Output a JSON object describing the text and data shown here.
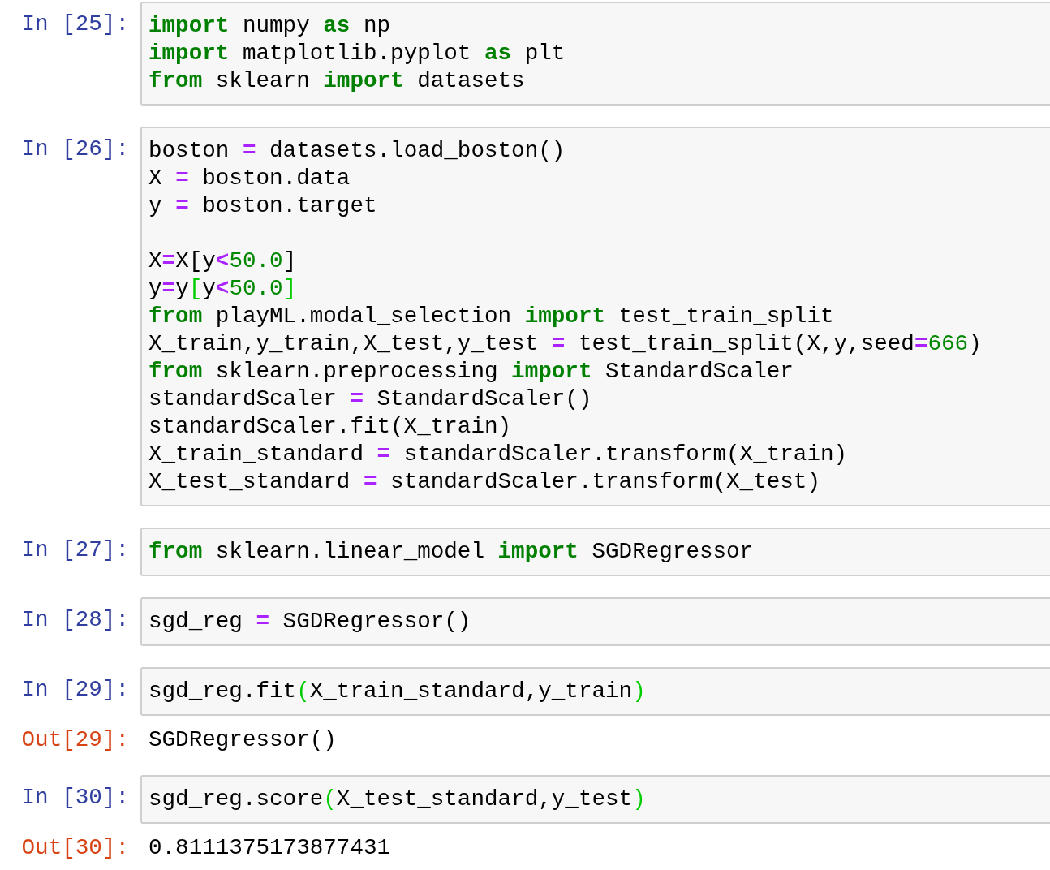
{
  "cells": [
    {
      "prompt": "In [25]:",
      "lines": [
        {
          "tokens": [
            {
              "kind": "kw",
              "text": "import"
            },
            {
              "kind": "plain",
              "text": " numpy "
            },
            {
              "kind": "kw",
              "text": "as"
            },
            {
              "kind": "plain",
              "text": " np"
            }
          ]
        },
        {
          "tokens": [
            {
              "kind": "kw",
              "text": "import"
            },
            {
              "kind": "plain",
              "text": " matplotlib.pyplot "
            },
            {
              "kind": "kw",
              "text": "as"
            },
            {
              "kind": "plain",
              "text": " plt"
            }
          ]
        },
        {
          "tokens": [
            {
              "kind": "kw",
              "text": "from"
            },
            {
              "kind": "plain",
              "text": " sklearn "
            },
            {
              "kind": "kw",
              "text": "import"
            },
            {
              "kind": "plain",
              "text": " datasets"
            }
          ]
        }
      ]
    },
    {
      "prompt": "In [26]:",
      "lines": [
        {
          "tokens": [
            {
              "kind": "plain",
              "text": "boston "
            },
            {
              "kind": "op",
              "text": "="
            },
            {
              "kind": "plain",
              "text": " datasets.load_boston()"
            }
          ]
        },
        {
          "tokens": [
            {
              "kind": "plain",
              "text": "X "
            },
            {
              "kind": "op",
              "text": "="
            },
            {
              "kind": "plain",
              "text": " boston.data"
            }
          ]
        },
        {
          "tokens": [
            {
              "kind": "plain",
              "text": "y "
            },
            {
              "kind": "op",
              "text": "="
            },
            {
              "kind": "plain",
              "text": " boston.target"
            }
          ]
        },
        {
          "gap_before": true,
          "tokens": [
            {
              "kind": "plain",
              "text": "X"
            },
            {
              "kind": "op",
              "text": "="
            },
            {
              "kind": "plain",
              "text": "X[y"
            },
            {
              "kind": "op",
              "text": "<"
            },
            {
              "kind": "num",
              "text": "50.0"
            },
            {
              "kind": "plain",
              "text": "]"
            }
          ]
        },
        {
          "tokens": [
            {
              "kind": "plain",
              "text": "y"
            },
            {
              "kind": "op",
              "text": "="
            },
            {
              "kind": "plain",
              "text": "y"
            },
            {
              "kind": "match",
              "text": "["
            },
            {
              "kind": "plain",
              "text": "y"
            },
            {
              "kind": "op",
              "text": "<"
            },
            {
              "kind": "num",
              "text": "50.0"
            },
            {
              "kind": "match",
              "text": "]"
            }
          ]
        },
        {
          "tokens": [
            {
              "kind": "kw",
              "text": "from"
            },
            {
              "kind": "plain",
              "text": " playML.modal_selection "
            },
            {
              "kind": "kw",
              "text": "import"
            },
            {
              "kind": "plain",
              "text": " test_train_split"
            }
          ]
        },
        {
          "tokens": [
            {
              "kind": "plain",
              "text": "X_train,y_train,X_test,y_test "
            },
            {
              "kind": "op",
              "text": "="
            },
            {
              "kind": "plain",
              "text": " test_train_split(X,y,seed"
            },
            {
              "kind": "op",
              "text": "="
            },
            {
              "kind": "num",
              "text": "666"
            },
            {
              "kind": "plain",
              "text": ")"
            }
          ]
        },
        {
          "tokens": [
            {
              "kind": "kw",
              "text": "from"
            },
            {
              "kind": "plain",
              "text": " sklearn.preprocessing "
            },
            {
              "kind": "kw",
              "text": "import"
            },
            {
              "kind": "plain",
              "text": " StandardScaler"
            }
          ]
        },
        {
          "tokens": [
            {
              "kind": "plain",
              "text": "standardScaler "
            },
            {
              "kind": "op",
              "text": "="
            },
            {
              "kind": "plain",
              "text": " StandardScaler()"
            }
          ]
        },
        {
          "tokens": [
            {
              "kind": "plain",
              "text": "standardScaler.fit(X_train)"
            }
          ]
        },
        {
          "tokens": [
            {
              "kind": "plain",
              "text": "X_train_standard "
            },
            {
              "kind": "op",
              "text": "="
            },
            {
              "kind": "plain",
              "text": " standardScaler.transform(X_train)"
            }
          ]
        },
        {
          "tokens": [
            {
              "kind": "plain",
              "text": "X_test_standard "
            },
            {
              "kind": "op",
              "text": "="
            },
            {
              "kind": "plain",
              "text": " standardScaler.transform(X_test)"
            }
          ]
        }
      ]
    },
    {
      "prompt": "In [27]:",
      "lines": [
        {
          "tokens": [
            {
              "kind": "kw",
              "text": "from"
            },
            {
              "kind": "plain",
              "text": " sklearn.linear_model "
            },
            {
              "kind": "kw",
              "text": "import"
            },
            {
              "kind": "plain",
              "text": " SGDRegressor"
            }
          ]
        }
      ]
    },
    {
      "prompt": "In [28]:",
      "lines": [
        {
          "tokens": [
            {
              "kind": "plain",
              "text": "sgd_reg "
            },
            {
              "kind": "op",
              "text": "="
            },
            {
              "kind": "plain",
              "text": " SGDRegressor()"
            }
          ]
        }
      ]
    },
    {
      "prompt": "In [29]:",
      "lines": [
        {
          "tokens": [
            {
              "kind": "plain",
              "text": "sgd_reg.fit"
            },
            {
              "kind": "match",
              "text": "("
            },
            {
              "kind": "plain",
              "text": "X_train_standard,y_train"
            },
            {
              "kind": "match",
              "text": ")"
            }
          ]
        }
      ],
      "output": {
        "prompt": "Out[29]:",
        "text": "SGDRegressor()"
      }
    },
    {
      "prompt": "In [30]:",
      "lines": [
        {
          "tokens": [
            {
              "kind": "plain",
              "text": "sgd_reg.score"
            },
            {
              "kind": "match",
              "text": "("
            },
            {
              "kind": "plain",
              "text": "X_test_standard,y_test"
            },
            {
              "kind": "match",
              "text": ")"
            }
          ]
        }
      ],
      "output": {
        "prompt": "Out[30]:",
        "text": "0.8111375173877431"
      }
    }
  ]
}
